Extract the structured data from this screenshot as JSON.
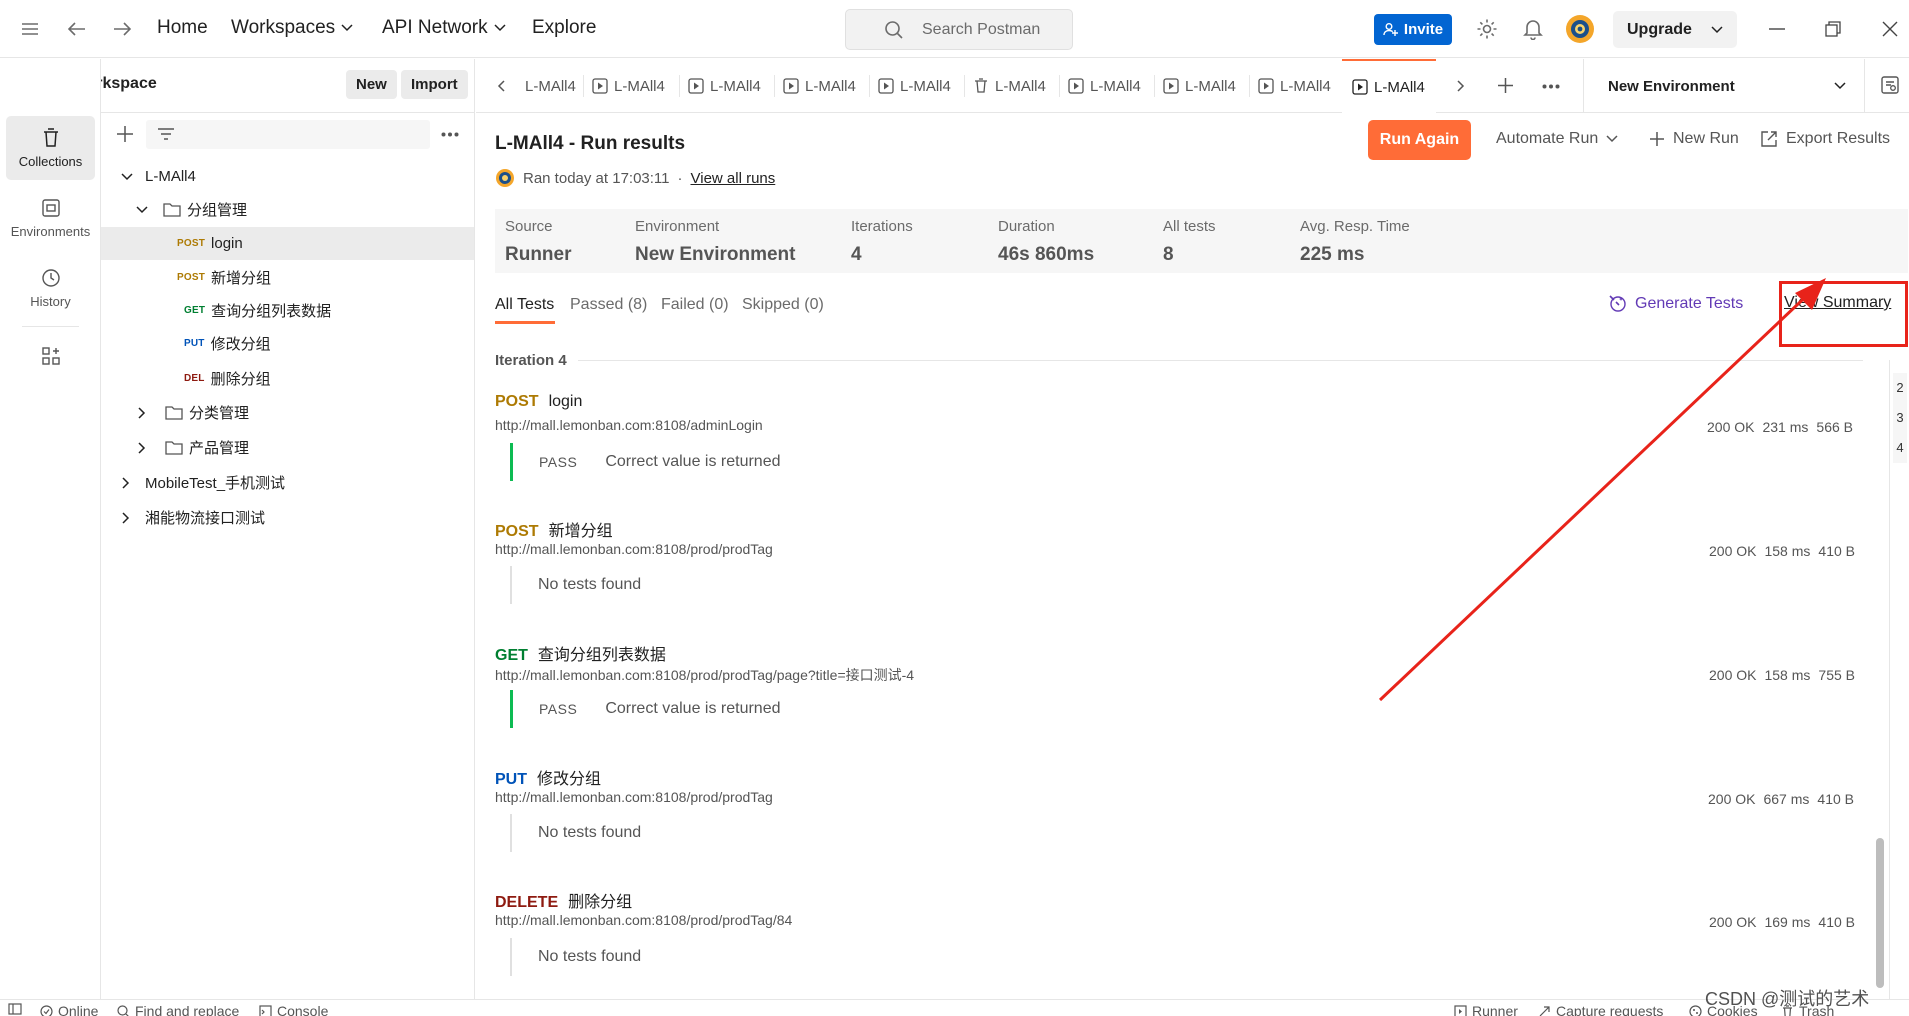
{
  "topbar": {
    "nav": {
      "home": "Home",
      "workspaces": "Workspaces",
      "api_network": "API Network",
      "explore": "Explore"
    },
    "search_placeholder": "Search Postman",
    "invite": "Invite",
    "upgrade": "Upgrade"
  },
  "rail": {
    "workspace": "My Workspace",
    "new": "New",
    "import": "Import",
    "items": [
      {
        "label": "Collections"
      },
      {
        "label": "Environments"
      },
      {
        "label": "History"
      }
    ]
  },
  "sidebar": {
    "collections": {
      "lmall": "L-MAll4",
      "folder_group": "分组管理",
      "requests": [
        {
          "method": "POST",
          "name": "login"
        },
        {
          "method": "POST",
          "name": "新增分组"
        },
        {
          "method": "GET",
          "name": "查询分组列表数据"
        },
        {
          "method": "PUT",
          "name": "修改分组"
        },
        {
          "method": "DEL",
          "name": "删除分组"
        }
      ],
      "folder_category": "分类管理",
      "folder_product": "产品管理",
      "mobile": "MobileTest_手机测试",
      "logistics": "湘能物流接口测试"
    }
  },
  "tabs": {
    "label": "L-MAll4",
    "environment": "New Environment"
  },
  "run": {
    "title": "L-MAll4 - Run results",
    "ran_at": "Ran today at 17:03:11",
    "dot": "·",
    "view_all_runs": "View all runs",
    "run_again": "Run Again",
    "automate": "Automate Run",
    "new_run": "New Run",
    "export": "Export Results",
    "stats": [
      {
        "label": "Source",
        "value": "Runner"
      },
      {
        "label": "Environment",
        "value": "New Environment"
      },
      {
        "label": "Iterations",
        "value": "4"
      },
      {
        "label": "Duration",
        "value": "46s 860ms"
      },
      {
        "label": "All tests",
        "value": "8"
      },
      {
        "label": "Avg. Resp. Time",
        "value": "225 ms"
      }
    ],
    "filters": {
      "all": "All Tests",
      "passed": "Passed (8)",
      "failed": "Failed (0)",
      "skipped": "Skipped (0)"
    },
    "generate_tests": "Generate Tests",
    "view_summary": "View Summary",
    "iteration": "Iteration 4",
    "requests": [
      {
        "method": "POST",
        "name": "login",
        "url": "http://mall.lemonban.com:8108/adminLogin",
        "status": "200 OK",
        "time": "231 ms",
        "size": "566 B",
        "result_label": "PASS",
        "result_text": "Correct value is returned"
      },
      {
        "method": "POST",
        "name": "新增分组",
        "url": "http://mall.lemonban.com:8108/prod/prodTag",
        "status": "200 OK",
        "time": "158 ms",
        "size": "410 B",
        "result_label": "",
        "result_text": "No tests found"
      },
      {
        "method": "GET",
        "name": "查询分组列表数据",
        "url": "http://mall.lemonban.com:8108/prod/prodTag/page?title=接口测试-4",
        "status": "200 OK",
        "time": "158 ms",
        "size": "755 B",
        "result_label": "PASS",
        "result_text": "Correct value is returned"
      },
      {
        "method": "PUT",
        "name": "修改分组",
        "url": "http://mall.lemonban.com:8108/prod/prodTag",
        "status": "200 OK",
        "time": "667 ms",
        "size": "410 B",
        "result_label": "",
        "result_text": "No tests found"
      },
      {
        "method": "DELETE",
        "name": "删除分组",
        "url": "http://mall.lemonban.com:8108/prod/prodTag/84",
        "status": "200 OK",
        "time": "169 ms",
        "size": "410 B",
        "result_label": "",
        "result_text": "No tests found"
      }
    ],
    "side_numbers": [
      "2",
      "3",
      "4"
    ]
  },
  "statusbar": {
    "online": "Online",
    "find_replace": "Find and replace",
    "console": "Console",
    "runner": "Runner",
    "capture": "Capture requests",
    "cookies": "Cookies",
    "trash": "Trash"
  },
  "watermark": "CSDN @测试的艺术",
  "colors": {
    "accent": "#ff6c37",
    "invite_blue": "#0265d2",
    "post": "#ad7a03",
    "get": "#007f31",
    "put": "#0053b8",
    "delete": "#8e1a10",
    "pass_green": "#0cbb52",
    "annotation_red": "#e8231a"
  }
}
